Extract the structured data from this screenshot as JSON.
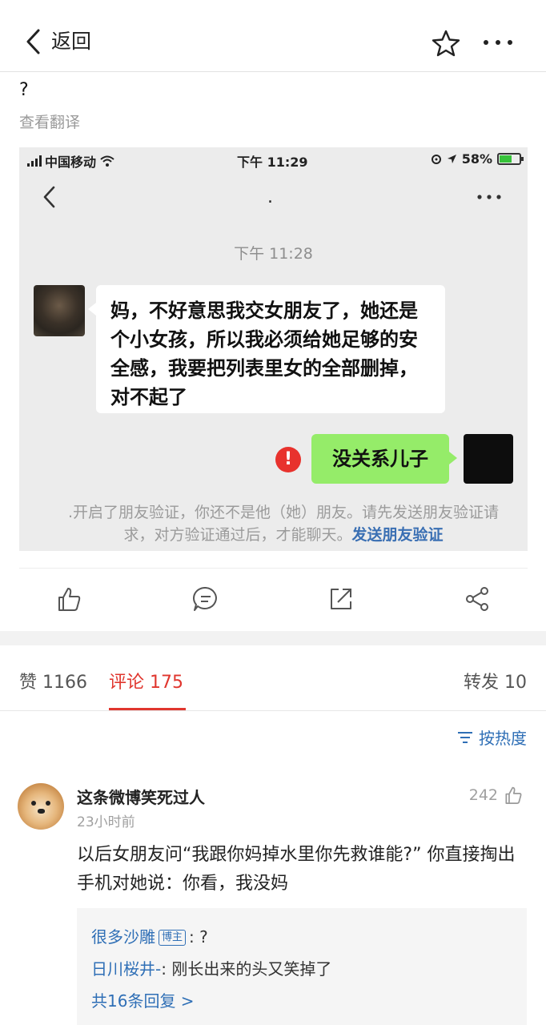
{
  "header": {
    "back_label": "返回"
  },
  "post": {
    "text": "?",
    "translate_label": "查看翻译"
  },
  "screenshot": {
    "status_bar": {
      "carrier": "中国移动",
      "time": "下午 11:29",
      "battery": "58%"
    },
    "chat_title": ".",
    "timestamp": "下午 11:28",
    "message_in": "妈，不好意思我交女朋友了，她还是个小女孩，所以我必须给她足够的安全感，我要把列表里女的全部删掉，对不起了",
    "message_out": "没关系儿子",
    "error_mark": "!",
    "system_text": ".开启了朋友验证，你还不是他（她）朋友。请先发送朋友验证请求，对方验证通过后，才能聊天。",
    "system_link": "发送朋友验证"
  },
  "tabs": {
    "like": "赞 1166",
    "comment": "评论 175",
    "repost": "转发 10"
  },
  "sort_label": "按热度",
  "comment": {
    "user": "这条微博笑死过人",
    "time": "23小时前",
    "likes": "242",
    "text": "以后女朋友问“我跟你妈掉水里你先救谁能?” 你直接掏出手机对她说：你看，我没妈",
    "replies": [
      {
        "user": "很多沙雕",
        "badge": "博主",
        "text": ": ?"
      },
      {
        "user": "日川桜井-",
        "text": ": 刚长出来的头又笑掉了"
      }
    ],
    "more_replies": "共16条回复 >"
  },
  "colors": {
    "accent_red": "#e0362e",
    "link_blue": "#2f6fb6",
    "wechat_green": "#95ec69"
  },
  "icons": [
    "back-chevron-icon",
    "star-icon",
    "more-dots-icon",
    "thumbs-up-icon",
    "comment-icon",
    "share-icon",
    "forward-icon",
    "sort-icon"
  ]
}
